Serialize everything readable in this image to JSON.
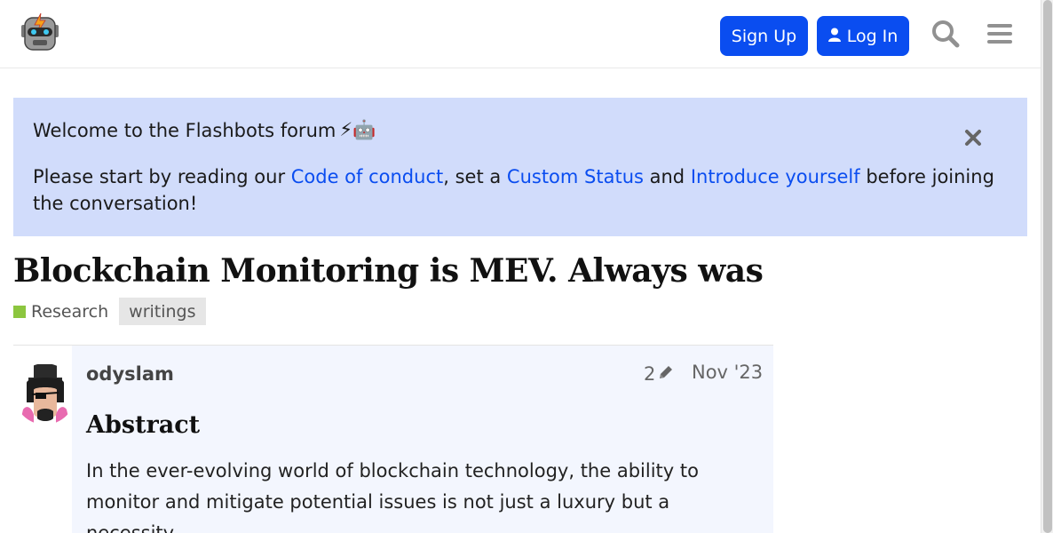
{
  "header": {
    "signup_label": "Sign Up",
    "login_label": "Log In",
    "accent_color": "#0a4df0"
  },
  "banner": {
    "title": "Welcome to the Flashbots forum",
    "title_emoji": "⚡🤖",
    "text_before": "Please start by reading our ",
    "link_conduct": "Code of conduct",
    "text_mid1": ", set a ",
    "link_status": "Custom Status",
    "text_mid2": " and ",
    "link_intro": "Introduce yourself",
    "text_after": " before joining the conversation!",
    "background": "#d1dcfb"
  },
  "topic": {
    "title": "Blockchain Monitoring is MEV. Always was",
    "category": "Research",
    "category_color": "#8cc63f",
    "tag": "writings"
  },
  "post": {
    "username": "odyslam",
    "edit_count": "2",
    "date": "Nov '23",
    "heading": "Abstract",
    "paragraph": "In the ever-evolving world of blockchain technology, the ability to monitor and mitigate potential issues is not just a luxury but a necessity."
  },
  "icons": [
    "robot-logo-icon",
    "user-icon",
    "search-icon",
    "hamburger-menu-icon",
    "close-icon",
    "pencil-icon",
    "avatar"
  ]
}
